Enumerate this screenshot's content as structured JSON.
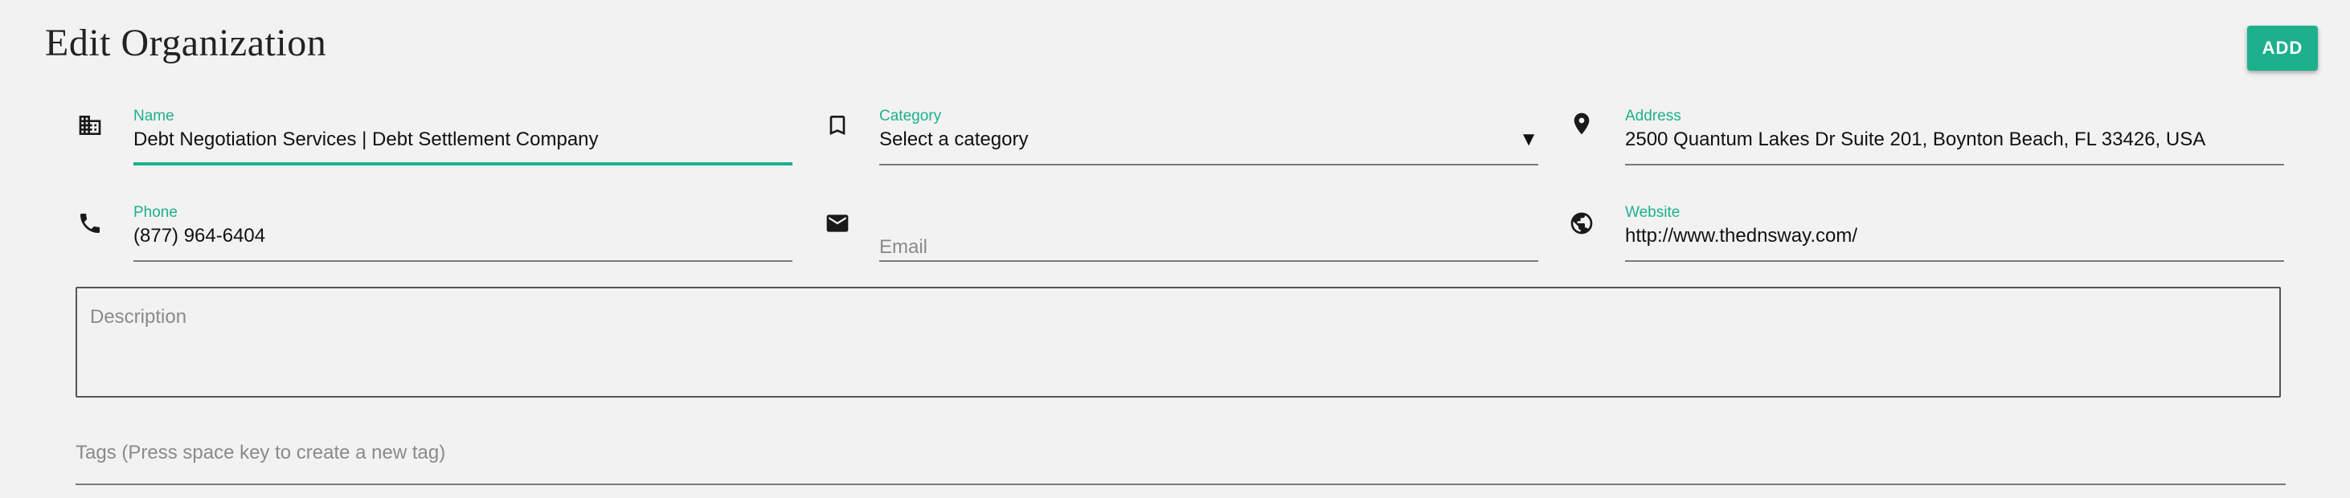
{
  "header": {
    "title": "Edit Organization",
    "add_label": "ADD"
  },
  "fields": {
    "name": {
      "label": "Name",
      "value": "Debt Negotiation Services | Debt Settlement Company",
      "icon": "building-icon"
    },
    "category": {
      "label": "Category",
      "value": "Select a category",
      "arrow": "▼",
      "icon": "bookmark-icon"
    },
    "address": {
      "label": "Address",
      "value": "2500 Quantum Lakes Dr Suite 201, Boynton Beach, FL 33426, USA",
      "icon": "location-pin-icon"
    },
    "phone": {
      "label": "Phone",
      "value": "(877) 964-6404",
      "icon": "phone-icon"
    },
    "email": {
      "placeholder": "Email",
      "value": "",
      "icon": "mail-icon"
    },
    "website": {
      "label": "Website",
      "value": "http://www.thednsway.com/",
      "icon": "globe-icon"
    }
  },
  "description": {
    "placeholder": "Description",
    "value": ""
  },
  "tags": {
    "placeholder": "Tags (Press space key to create a new tag)"
  },
  "colors": {
    "accent": "#1db08e",
    "background": "#f2f2f2",
    "text": "#212121",
    "placeholder": "#8a8a8a"
  }
}
